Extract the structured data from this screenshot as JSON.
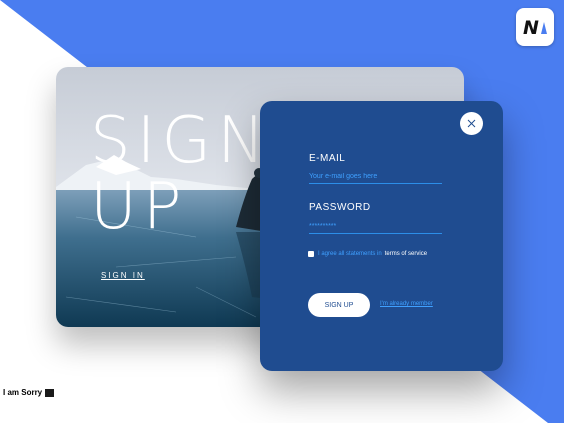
{
  "logo": {
    "letter": "N",
    "accent": "#4a7df0"
  },
  "hero": {
    "title": "SIGN\nUP",
    "signin_label": "SIGN IN"
  },
  "form": {
    "email_label": "E-MAIL",
    "email_placeholder": "Your e-mail goes here",
    "password_label": "PASSWORD",
    "password_value": "**********",
    "terms_text": "I agree all statements in",
    "terms_link": "terms of service",
    "signup_button": "SIGN UP",
    "member_link": "I'm already member"
  },
  "caption": "I am Sorry",
  "colors": {
    "background_accent": "#4a7df0",
    "panel": "#1f4c90",
    "input_accent": "#3fa0ff",
    "underline": "#2c8ee8"
  },
  "icons": {
    "close": "close-icon",
    "logo": "brand-logo-icon"
  }
}
